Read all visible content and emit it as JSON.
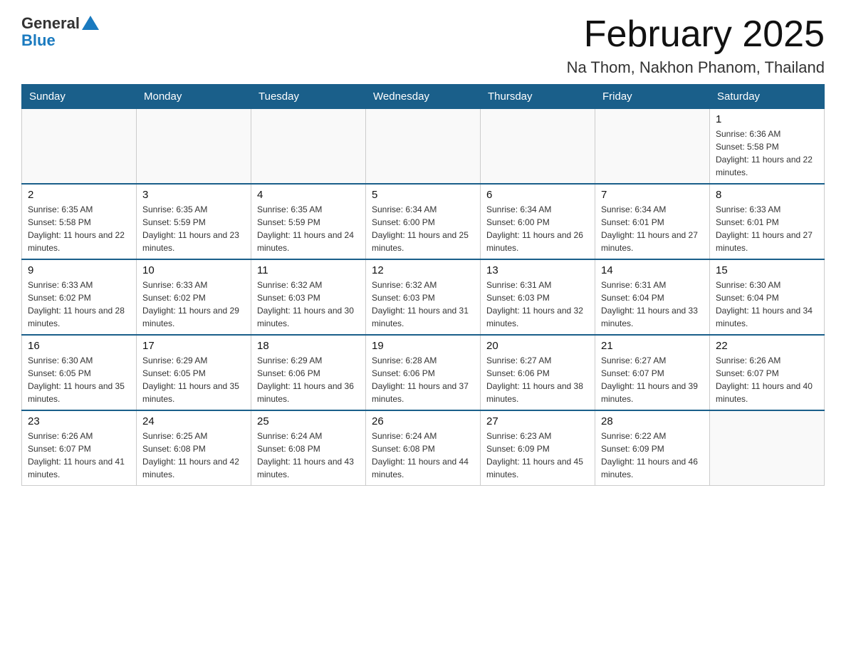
{
  "header": {
    "logo_general": "General",
    "logo_blue": "Blue",
    "main_title": "February 2025",
    "subtitle": "Na Thom, Nakhon Phanom, Thailand"
  },
  "days_of_week": [
    "Sunday",
    "Monday",
    "Tuesday",
    "Wednesday",
    "Thursday",
    "Friday",
    "Saturday"
  ],
  "weeks": [
    [
      {
        "day": "",
        "sunrise": "",
        "sunset": "",
        "daylight": "",
        "empty": true
      },
      {
        "day": "",
        "sunrise": "",
        "sunset": "",
        "daylight": "",
        "empty": true
      },
      {
        "day": "",
        "sunrise": "",
        "sunset": "",
        "daylight": "",
        "empty": true
      },
      {
        "day": "",
        "sunrise": "",
        "sunset": "",
        "daylight": "",
        "empty": true
      },
      {
        "day": "",
        "sunrise": "",
        "sunset": "",
        "daylight": "",
        "empty": true
      },
      {
        "day": "",
        "sunrise": "",
        "sunset": "",
        "daylight": "",
        "empty": true
      },
      {
        "day": "1",
        "sunrise": "Sunrise: 6:36 AM",
        "sunset": "Sunset: 5:58 PM",
        "daylight": "Daylight: 11 hours and 22 minutes.",
        "empty": false
      }
    ],
    [
      {
        "day": "2",
        "sunrise": "Sunrise: 6:35 AM",
        "sunset": "Sunset: 5:58 PM",
        "daylight": "Daylight: 11 hours and 22 minutes.",
        "empty": false
      },
      {
        "day": "3",
        "sunrise": "Sunrise: 6:35 AM",
        "sunset": "Sunset: 5:59 PM",
        "daylight": "Daylight: 11 hours and 23 minutes.",
        "empty": false
      },
      {
        "day": "4",
        "sunrise": "Sunrise: 6:35 AM",
        "sunset": "Sunset: 5:59 PM",
        "daylight": "Daylight: 11 hours and 24 minutes.",
        "empty": false
      },
      {
        "day": "5",
        "sunrise": "Sunrise: 6:34 AM",
        "sunset": "Sunset: 6:00 PM",
        "daylight": "Daylight: 11 hours and 25 minutes.",
        "empty": false
      },
      {
        "day": "6",
        "sunrise": "Sunrise: 6:34 AM",
        "sunset": "Sunset: 6:00 PM",
        "daylight": "Daylight: 11 hours and 26 minutes.",
        "empty": false
      },
      {
        "day": "7",
        "sunrise": "Sunrise: 6:34 AM",
        "sunset": "Sunset: 6:01 PM",
        "daylight": "Daylight: 11 hours and 27 minutes.",
        "empty": false
      },
      {
        "day": "8",
        "sunrise": "Sunrise: 6:33 AM",
        "sunset": "Sunset: 6:01 PM",
        "daylight": "Daylight: 11 hours and 27 minutes.",
        "empty": false
      }
    ],
    [
      {
        "day": "9",
        "sunrise": "Sunrise: 6:33 AM",
        "sunset": "Sunset: 6:02 PM",
        "daylight": "Daylight: 11 hours and 28 minutes.",
        "empty": false
      },
      {
        "day": "10",
        "sunrise": "Sunrise: 6:33 AM",
        "sunset": "Sunset: 6:02 PM",
        "daylight": "Daylight: 11 hours and 29 minutes.",
        "empty": false
      },
      {
        "day": "11",
        "sunrise": "Sunrise: 6:32 AM",
        "sunset": "Sunset: 6:03 PM",
        "daylight": "Daylight: 11 hours and 30 minutes.",
        "empty": false
      },
      {
        "day": "12",
        "sunrise": "Sunrise: 6:32 AM",
        "sunset": "Sunset: 6:03 PM",
        "daylight": "Daylight: 11 hours and 31 minutes.",
        "empty": false
      },
      {
        "day": "13",
        "sunrise": "Sunrise: 6:31 AM",
        "sunset": "Sunset: 6:03 PM",
        "daylight": "Daylight: 11 hours and 32 minutes.",
        "empty": false
      },
      {
        "day": "14",
        "sunrise": "Sunrise: 6:31 AM",
        "sunset": "Sunset: 6:04 PM",
        "daylight": "Daylight: 11 hours and 33 minutes.",
        "empty": false
      },
      {
        "day": "15",
        "sunrise": "Sunrise: 6:30 AM",
        "sunset": "Sunset: 6:04 PM",
        "daylight": "Daylight: 11 hours and 34 minutes.",
        "empty": false
      }
    ],
    [
      {
        "day": "16",
        "sunrise": "Sunrise: 6:30 AM",
        "sunset": "Sunset: 6:05 PM",
        "daylight": "Daylight: 11 hours and 35 minutes.",
        "empty": false
      },
      {
        "day": "17",
        "sunrise": "Sunrise: 6:29 AM",
        "sunset": "Sunset: 6:05 PM",
        "daylight": "Daylight: 11 hours and 35 minutes.",
        "empty": false
      },
      {
        "day": "18",
        "sunrise": "Sunrise: 6:29 AM",
        "sunset": "Sunset: 6:06 PM",
        "daylight": "Daylight: 11 hours and 36 minutes.",
        "empty": false
      },
      {
        "day": "19",
        "sunrise": "Sunrise: 6:28 AM",
        "sunset": "Sunset: 6:06 PM",
        "daylight": "Daylight: 11 hours and 37 minutes.",
        "empty": false
      },
      {
        "day": "20",
        "sunrise": "Sunrise: 6:27 AM",
        "sunset": "Sunset: 6:06 PM",
        "daylight": "Daylight: 11 hours and 38 minutes.",
        "empty": false
      },
      {
        "day": "21",
        "sunrise": "Sunrise: 6:27 AM",
        "sunset": "Sunset: 6:07 PM",
        "daylight": "Daylight: 11 hours and 39 minutes.",
        "empty": false
      },
      {
        "day": "22",
        "sunrise": "Sunrise: 6:26 AM",
        "sunset": "Sunset: 6:07 PM",
        "daylight": "Daylight: 11 hours and 40 minutes.",
        "empty": false
      }
    ],
    [
      {
        "day": "23",
        "sunrise": "Sunrise: 6:26 AM",
        "sunset": "Sunset: 6:07 PM",
        "daylight": "Daylight: 11 hours and 41 minutes.",
        "empty": false
      },
      {
        "day": "24",
        "sunrise": "Sunrise: 6:25 AM",
        "sunset": "Sunset: 6:08 PM",
        "daylight": "Daylight: 11 hours and 42 minutes.",
        "empty": false
      },
      {
        "day": "25",
        "sunrise": "Sunrise: 6:24 AM",
        "sunset": "Sunset: 6:08 PM",
        "daylight": "Daylight: 11 hours and 43 minutes.",
        "empty": false
      },
      {
        "day": "26",
        "sunrise": "Sunrise: 6:24 AM",
        "sunset": "Sunset: 6:08 PM",
        "daylight": "Daylight: 11 hours and 44 minutes.",
        "empty": false
      },
      {
        "day": "27",
        "sunrise": "Sunrise: 6:23 AM",
        "sunset": "Sunset: 6:09 PM",
        "daylight": "Daylight: 11 hours and 45 minutes.",
        "empty": false
      },
      {
        "day": "28",
        "sunrise": "Sunrise: 6:22 AM",
        "sunset": "Sunset: 6:09 PM",
        "daylight": "Daylight: 11 hours and 46 minutes.",
        "empty": false
      },
      {
        "day": "",
        "sunrise": "",
        "sunset": "",
        "daylight": "",
        "empty": true
      }
    ]
  ]
}
